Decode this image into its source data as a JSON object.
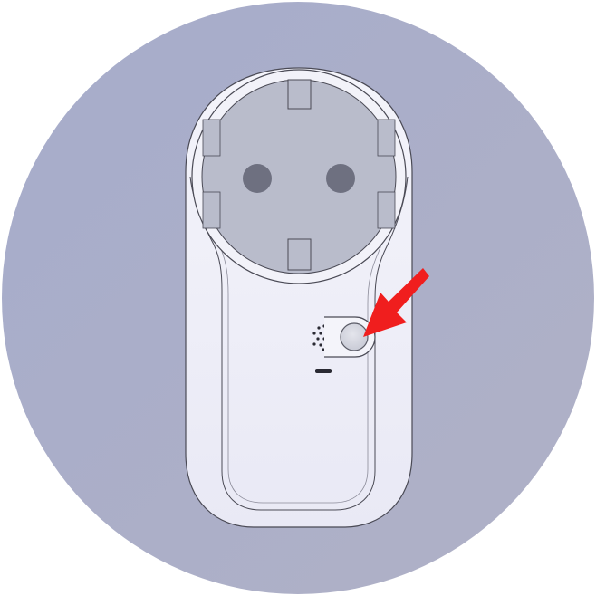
{
  "illustration": {
    "subject": "smart-plug",
    "highlight": "pairing-button",
    "colors": {
      "background_circle": "#A8AECA",
      "plug_body": "#F2F2FA",
      "plug_outline": "#4A4A55",
      "socket_face": "#B9BCCB",
      "socket_hole": "#6E7080",
      "button_fill": "#D4D6E0",
      "indicator": "#2A2A33",
      "arrow": "#F01E1E"
    },
    "icons": [
      "socket-icon",
      "speaker-icon",
      "pairing-button-icon",
      "led-indicator-icon",
      "arrow-icon"
    ]
  }
}
